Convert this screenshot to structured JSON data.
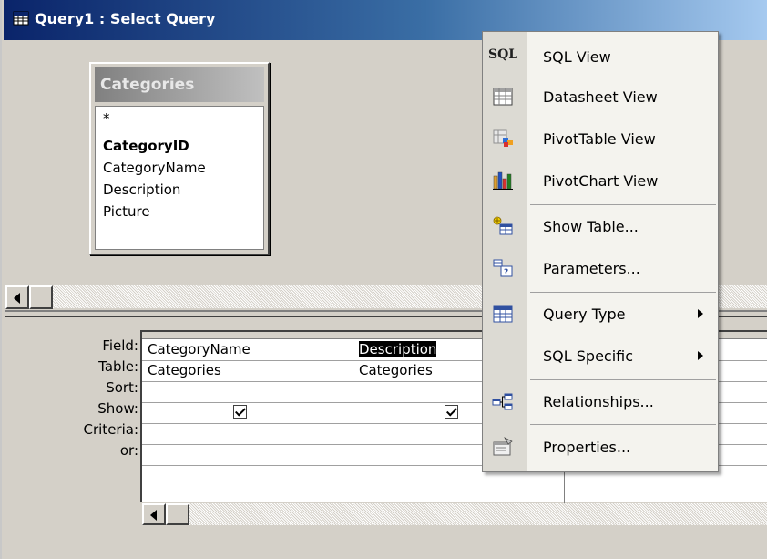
{
  "window": {
    "title": "Query1 : Select Query"
  },
  "field_list": {
    "title": "Categories",
    "fields": [
      "*",
      "CategoryID",
      "CategoryName",
      "Description",
      "Picture"
    ]
  },
  "grid": {
    "row_labels": [
      "Field:",
      "Table:",
      "Sort:",
      "Show:",
      "Criteria:",
      "or:"
    ],
    "columns": [
      {
        "field": "CategoryName",
        "table": "Categories",
        "sort": "",
        "show": true,
        "criteria": "",
        "or": ""
      },
      {
        "field": "Description",
        "table": "Categories",
        "sort": "",
        "show": true,
        "criteria": "",
        "or": ""
      }
    ]
  },
  "context_menu": {
    "items": [
      {
        "label": "SQL View",
        "icon": "sql-icon"
      },
      {
        "label": "Datasheet View",
        "icon": "datasheet-icon"
      },
      {
        "label": "PivotTable View",
        "icon": "pivottable-icon"
      },
      {
        "label": "PivotChart View",
        "icon": "pivotchart-icon"
      },
      {
        "label": "Show Table...",
        "icon": "show-table-icon"
      },
      {
        "label": "Parameters...",
        "icon": "parameters-icon"
      },
      {
        "label": "Query Type",
        "icon": "query-type-icon",
        "submenu": true
      },
      {
        "label": "SQL Specific",
        "submenu": true
      },
      {
        "label": "Relationships...",
        "icon": "relationships-icon"
      },
      {
        "label": "Properties...",
        "icon": "properties-icon"
      }
    ]
  }
}
